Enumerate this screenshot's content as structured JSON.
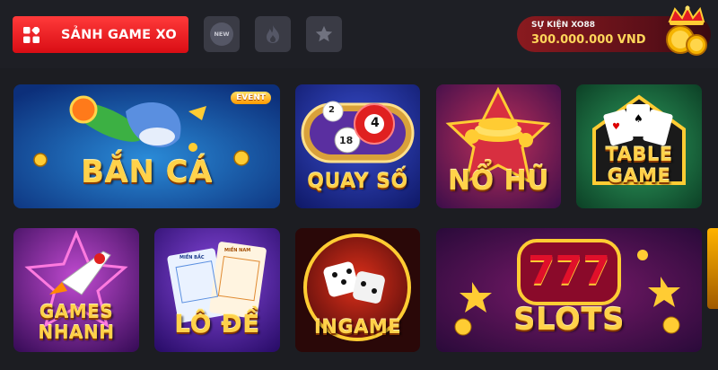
{
  "header": {
    "lobby_label": "SẢNH GAME XO",
    "filter_new_label": "NEW",
    "event_title": "SỰ KIỆN XO88",
    "event_amount": "300.000.000 VND"
  },
  "tiles": [
    {
      "title": "BẮN CÁ",
      "badge": "EVENT"
    },
    {
      "title": "QUAY SỐ"
    },
    {
      "title": "NỔ HŨ"
    },
    {
      "title_line1": "TABLE",
      "title_line2": "GAME"
    },
    {
      "title_line1": "GAMES",
      "title_line2": "NHANH"
    },
    {
      "title": "LÔ ĐỀ"
    },
    {
      "title": "INGAME"
    },
    {
      "title": "SLOTS",
      "number": "777"
    }
  ],
  "tile_extras": {
    "lode_ticket_left": "MIỀN BẮC",
    "lode_ticket_right": "MIỀN NAM",
    "ball_numbers": [
      "2",
      "18",
      "4"
    ]
  },
  "colors": {
    "accent_red": "#e01018",
    "gold": "#ffd24a",
    "background": "#1c1d22"
  }
}
